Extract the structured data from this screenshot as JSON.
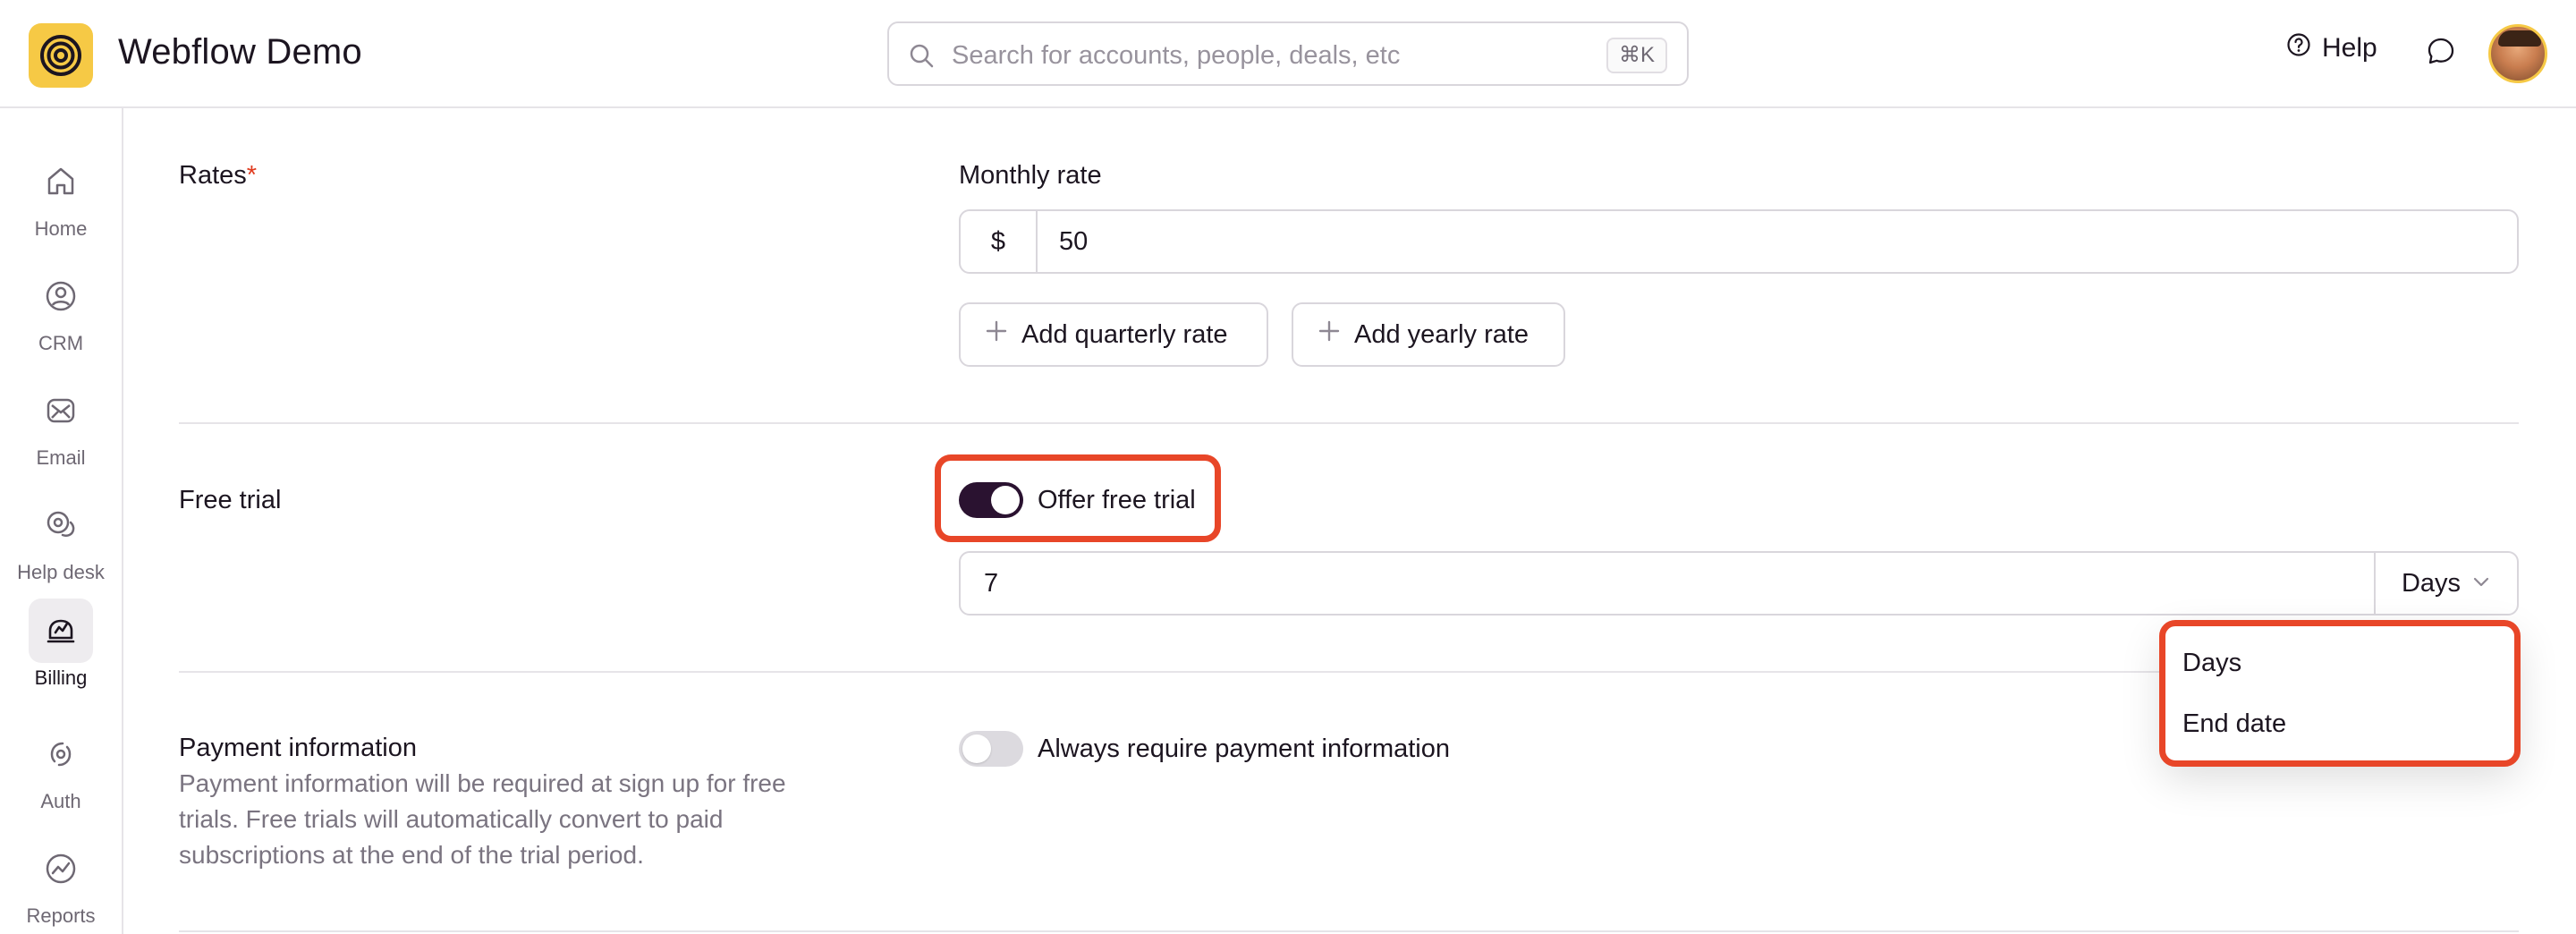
{
  "header": {
    "app_title": "Webflow Demo",
    "search_placeholder": "Search for accounts, people, deals, etc",
    "search_shortcut": "⌘K",
    "help_label": "Help"
  },
  "sidebar": {
    "items": [
      {
        "label": "Home",
        "icon": "home-icon"
      },
      {
        "label": "CRM",
        "icon": "user-circle-icon"
      },
      {
        "label": "Email",
        "icon": "mail-icon"
      },
      {
        "label": "Help desk",
        "icon": "chat-bubbles-icon"
      },
      {
        "label": "Billing",
        "icon": "billing-icon",
        "active": true
      },
      {
        "label": "Auth",
        "icon": "auth-icon"
      },
      {
        "label": "Reports",
        "icon": "chart-icon"
      }
    ]
  },
  "rates": {
    "label": "Rates",
    "required_mark": "*",
    "monthly_label": "Monthly rate",
    "currency_prefix": "$",
    "monthly_value": "50",
    "add_quarterly": "Add quarterly rate",
    "add_yearly": "Add yearly rate"
  },
  "free_trial": {
    "label": "Free trial",
    "toggle_label": "Offer free trial",
    "toggle_on": true,
    "duration_value": "7",
    "unit_selected": "Days",
    "unit_options": [
      "Days",
      "End date"
    ]
  },
  "payment": {
    "label": "Payment information",
    "description": "Payment information will be required at sign up for free trials. Free trials will automatically convert to paid subscriptions at the end of the trial period.",
    "toggle_label": "Always require payment information",
    "toggle_on": false
  },
  "colors": {
    "accent_dark": "#2a1230",
    "highlight": "#e84628",
    "logo_bg": "#f6c945",
    "required": "#e03a1e"
  }
}
